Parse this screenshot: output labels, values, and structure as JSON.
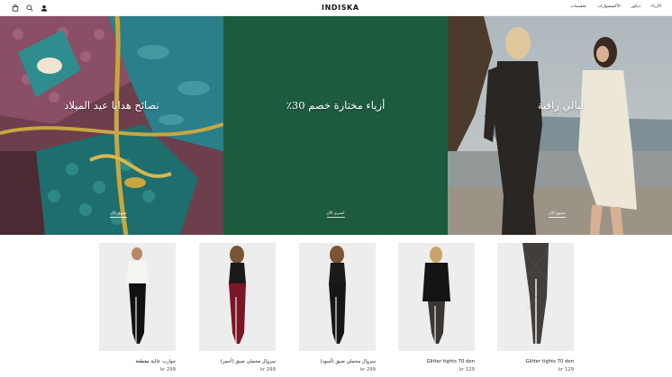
{
  "header": {
    "logo": "INDISKA",
    "nav": [
      "الأزياء",
      "ديكور",
      "الأكسسوارات",
      "تخفيضات"
    ]
  },
  "hero": [
    {
      "headline": "نصائح هدايا عيد الميلاد",
      "cta": "تسوق الآن"
    },
    {
      "headline": "أزياء مختارة خصم 30٪",
      "cta": "اشتري الآن"
    },
    {
      "headline": "ليالي راقية",
      "cta": "تسوق الآن"
    }
  ],
  "products": [
    {
      "name": "جوارب عالية مقطعة",
      "price": "kr 299"
    },
    {
      "name": "سروال مخملي ضيق (أحمر)",
      "price": "kr 299"
    },
    {
      "name": "سروال مخملي ضيق (أسود)",
      "price": "kr 299"
    },
    {
      "name": "Glitter tights 70 den",
      "price": "kr 129"
    },
    {
      "name": "Glitter tights 70 den",
      "price": "kr 129"
    }
  ],
  "icons": [
    "bag-icon",
    "search-icon",
    "user-icon"
  ],
  "colors": {
    "hero_green": "#1d5b3f",
    "text": "#222222"
  }
}
